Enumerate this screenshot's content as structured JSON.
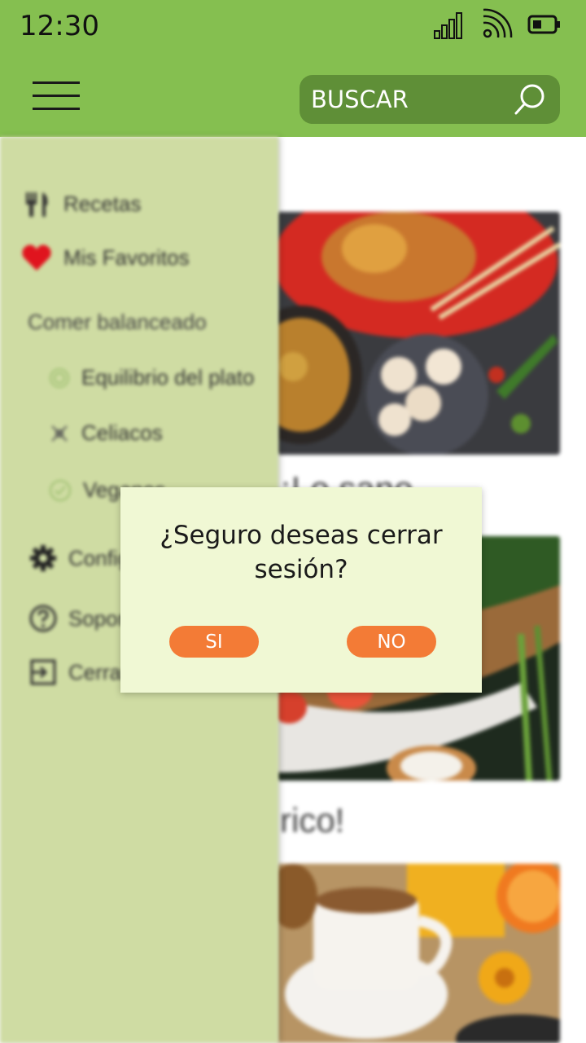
{
  "status_bar": {
    "time": "12:30",
    "icons": [
      "signal-icon",
      "wifi-icon",
      "battery-icon"
    ]
  },
  "app_bar": {
    "menu_icon": "hamburger-menu-icon",
    "search": {
      "placeholder": "BUSCAR",
      "icon": "search-icon"
    },
    "background_color": "#85bf50",
    "search_background_color": "#5f8f37"
  },
  "drawer": {
    "background_color": "#cfdca3",
    "items": [
      {
        "label": "Recetas",
        "icon": "fork-knife-icon"
      },
      {
        "label": "Mis Favoritos",
        "icon": "heart-icon"
      }
    ],
    "section_title": "Comer balanceado",
    "sub_items": [
      {
        "label": "Equilibrio del plato",
        "icon": "plate-icon"
      },
      {
        "label": "Celiacos",
        "icon": "no-wheat-icon"
      },
      {
        "label": "Veganos",
        "icon": "leaf-check-icon"
      }
    ],
    "bottom_items": [
      {
        "label": "Configuración",
        "icon": "gear-icon"
      },
      {
        "label": "Soporte",
        "icon": "help-circle-icon"
      },
      {
        "label": "Cerrar sesión",
        "icon": "logout-icon"
      }
    ]
  },
  "content": {
    "cards": [
      {
        "image": "asian-food-photo",
        "title": ""
      },
      {
        "image": "grilled-fish-photo",
        "title": "¡Lo sano"
      },
      {
        "image": "breakfast-coffee-photo",
        "title": "rico!"
      }
    ]
  },
  "dialog": {
    "message": "¿Seguro deseas cerrar sesión?",
    "confirm_label": "SI",
    "cancel_label": "NO",
    "background_color": "#f0f8d4",
    "button_color": "#f37b36"
  }
}
